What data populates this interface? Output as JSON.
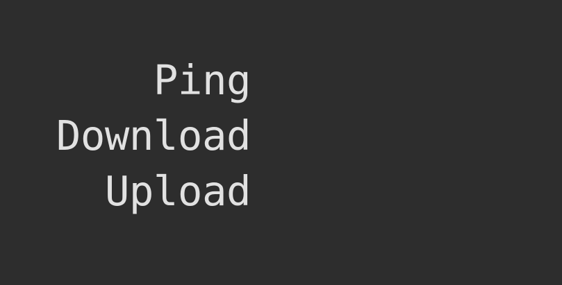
{
  "metrics": {
    "ping_label": "Ping",
    "download_label": "Download",
    "upload_label": "Upload"
  },
  "colors": {
    "background": "#2d2d2d",
    "text": "#e1e1e1"
  }
}
